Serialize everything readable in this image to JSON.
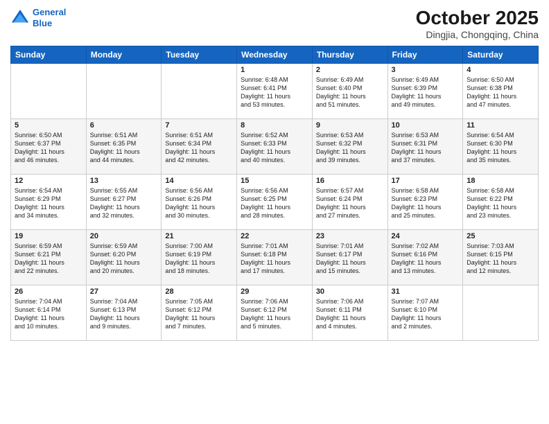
{
  "header": {
    "logo_line1": "General",
    "logo_line2": "Blue",
    "main_title": "October 2025",
    "subtitle": "Dingjia, Chongqing, China"
  },
  "days_of_week": [
    "Sunday",
    "Monday",
    "Tuesday",
    "Wednesday",
    "Thursday",
    "Friday",
    "Saturday"
  ],
  "weeks": [
    [
      {
        "day": "",
        "content": ""
      },
      {
        "day": "",
        "content": ""
      },
      {
        "day": "",
        "content": ""
      },
      {
        "day": "1",
        "content": "Sunrise: 6:48 AM\nSunset: 6:41 PM\nDaylight: 11 hours\nand 53 minutes."
      },
      {
        "day": "2",
        "content": "Sunrise: 6:49 AM\nSunset: 6:40 PM\nDaylight: 11 hours\nand 51 minutes."
      },
      {
        "day": "3",
        "content": "Sunrise: 6:49 AM\nSunset: 6:39 PM\nDaylight: 11 hours\nand 49 minutes."
      },
      {
        "day": "4",
        "content": "Sunrise: 6:50 AM\nSunset: 6:38 PM\nDaylight: 11 hours\nand 47 minutes."
      }
    ],
    [
      {
        "day": "5",
        "content": "Sunrise: 6:50 AM\nSunset: 6:37 PM\nDaylight: 11 hours\nand 46 minutes."
      },
      {
        "day": "6",
        "content": "Sunrise: 6:51 AM\nSunset: 6:35 PM\nDaylight: 11 hours\nand 44 minutes."
      },
      {
        "day": "7",
        "content": "Sunrise: 6:51 AM\nSunset: 6:34 PM\nDaylight: 11 hours\nand 42 minutes."
      },
      {
        "day": "8",
        "content": "Sunrise: 6:52 AM\nSunset: 6:33 PM\nDaylight: 11 hours\nand 40 minutes."
      },
      {
        "day": "9",
        "content": "Sunrise: 6:53 AM\nSunset: 6:32 PM\nDaylight: 11 hours\nand 39 minutes."
      },
      {
        "day": "10",
        "content": "Sunrise: 6:53 AM\nSunset: 6:31 PM\nDaylight: 11 hours\nand 37 minutes."
      },
      {
        "day": "11",
        "content": "Sunrise: 6:54 AM\nSunset: 6:30 PM\nDaylight: 11 hours\nand 35 minutes."
      }
    ],
    [
      {
        "day": "12",
        "content": "Sunrise: 6:54 AM\nSunset: 6:29 PM\nDaylight: 11 hours\nand 34 minutes."
      },
      {
        "day": "13",
        "content": "Sunrise: 6:55 AM\nSunset: 6:27 PM\nDaylight: 11 hours\nand 32 minutes."
      },
      {
        "day": "14",
        "content": "Sunrise: 6:56 AM\nSunset: 6:26 PM\nDaylight: 11 hours\nand 30 minutes."
      },
      {
        "day": "15",
        "content": "Sunrise: 6:56 AM\nSunset: 6:25 PM\nDaylight: 11 hours\nand 28 minutes."
      },
      {
        "day": "16",
        "content": "Sunrise: 6:57 AM\nSunset: 6:24 PM\nDaylight: 11 hours\nand 27 minutes."
      },
      {
        "day": "17",
        "content": "Sunrise: 6:58 AM\nSunset: 6:23 PM\nDaylight: 11 hours\nand 25 minutes."
      },
      {
        "day": "18",
        "content": "Sunrise: 6:58 AM\nSunset: 6:22 PM\nDaylight: 11 hours\nand 23 minutes."
      }
    ],
    [
      {
        "day": "19",
        "content": "Sunrise: 6:59 AM\nSunset: 6:21 PM\nDaylight: 11 hours\nand 22 minutes."
      },
      {
        "day": "20",
        "content": "Sunrise: 6:59 AM\nSunset: 6:20 PM\nDaylight: 11 hours\nand 20 minutes."
      },
      {
        "day": "21",
        "content": "Sunrise: 7:00 AM\nSunset: 6:19 PM\nDaylight: 11 hours\nand 18 minutes."
      },
      {
        "day": "22",
        "content": "Sunrise: 7:01 AM\nSunset: 6:18 PM\nDaylight: 11 hours\nand 17 minutes."
      },
      {
        "day": "23",
        "content": "Sunrise: 7:01 AM\nSunset: 6:17 PM\nDaylight: 11 hours\nand 15 minutes."
      },
      {
        "day": "24",
        "content": "Sunrise: 7:02 AM\nSunset: 6:16 PM\nDaylight: 11 hours\nand 13 minutes."
      },
      {
        "day": "25",
        "content": "Sunrise: 7:03 AM\nSunset: 6:15 PM\nDaylight: 11 hours\nand 12 minutes."
      }
    ],
    [
      {
        "day": "26",
        "content": "Sunrise: 7:04 AM\nSunset: 6:14 PM\nDaylight: 11 hours\nand 10 minutes."
      },
      {
        "day": "27",
        "content": "Sunrise: 7:04 AM\nSunset: 6:13 PM\nDaylight: 11 hours\nand 9 minutes."
      },
      {
        "day": "28",
        "content": "Sunrise: 7:05 AM\nSunset: 6:12 PM\nDaylight: 11 hours\nand 7 minutes."
      },
      {
        "day": "29",
        "content": "Sunrise: 7:06 AM\nSunset: 6:12 PM\nDaylight: 11 hours\nand 5 minutes."
      },
      {
        "day": "30",
        "content": "Sunrise: 7:06 AM\nSunset: 6:11 PM\nDaylight: 11 hours\nand 4 minutes."
      },
      {
        "day": "31",
        "content": "Sunrise: 7:07 AM\nSunset: 6:10 PM\nDaylight: 11 hours\nand 2 minutes."
      },
      {
        "day": "",
        "content": ""
      }
    ]
  ]
}
